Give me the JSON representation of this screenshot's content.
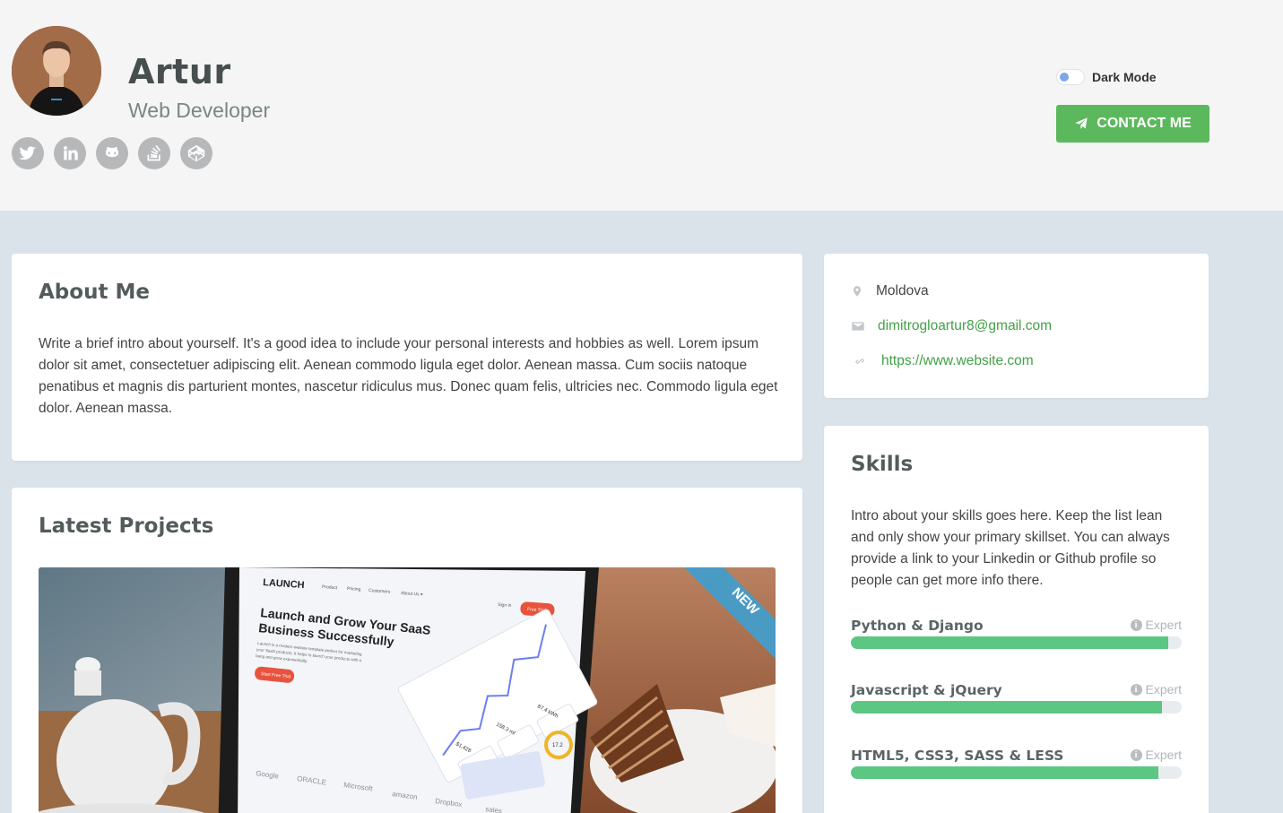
{
  "profile": {
    "name": "Artur",
    "tagline": "Web Developer"
  },
  "socials": [
    {
      "icon": "twitter-icon"
    },
    {
      "icon": "linkedin-icon"
    },
    {
      "icon": "github-icon"
    },
    {
      "icon": "stackoverflow-icon"
    },
    {
      "icon": "codepen-icon"
    }
  ],
  "header": {
    "dark_mode_label": "Dark Mode",
    "dark_mode_on": false,
    "contact_label": "CONTACT ME"
  },
  "about": {
    "title": "About Me",
    "text": "Write a brief intro about yourself. It's a good idea to include your personal interests and hobbies as well. Lorem ipsum dolor sit amet, consectetuer adipiscing elit. Aenean commodo ligula eget dolor. Aenean massa. Cum sociis natoque penatibus et magnis dis parturient montes, nascetur ridiculus mus. Donec quam felis, ultricies nec. Commodo ligula eget dolor. Aenean massa."
  },
  "projects": {
    "title": "Latest Projects",
    "featured": {
      "ribbon": "NEW",
      "brand": "LAUNCH",
      "nav": [
        "Product",
        "Pricing",
        "Customers",
        "About Us ▾"
      ],
      "sign_in": "Sign in",
      "free_trial": "Free Trial",
      "headline_1": "Launch and Grow Your SaaS",
      "headline_2": "Business Successfully",
      "body_1": "Launch is a modern website template perfect for marketing",
      "body_2": "your SaaS products. It helps to launch your products with a",
      "body_3": "bang and grow exponentially.",
      "cta": "Start Free Trial",
      "stats": [
        "$1,428",
        "158.3 ml",
        "87.4 kWh",
        "17.2"
      ],
      "logos": [
        "Google",
        "ORACLE",
        "Microsoft",
        "amazon",
        "Dropbox",
        "sales"
      ]
    }
  },
  "info": {
    "location": "Moldova",
    "email": "dimitrogloartur8@gmail.com",
    "website": "https://www.website.com"
  },
  "skills": {
    "title": "Skills",
    "intro": "Intro about your skills goes here. Keep the list lean and only show your primary skillset. You can always provide a link to your Linkedin or Github profile so people can get more info there.",
    "items": [
      {
        "name": "Python & Django",
        "level": "Expert",
        "percent": 96
      },
      {
        "name": "Javascript & jQuery",
        "level": "Expert",
        "percent": 94
      },
      {
        "name": "HTML5, CSS3, SASS & LESS",
        "level": "Expert",
        "percent": 93
      }
    ]
  },
  "colors": {
    "accent": "#5cb85c",
    "link": "#43a047",
    "bar": "#5cc683",
    "ribbon": "#4a9bc4"
  }
}
